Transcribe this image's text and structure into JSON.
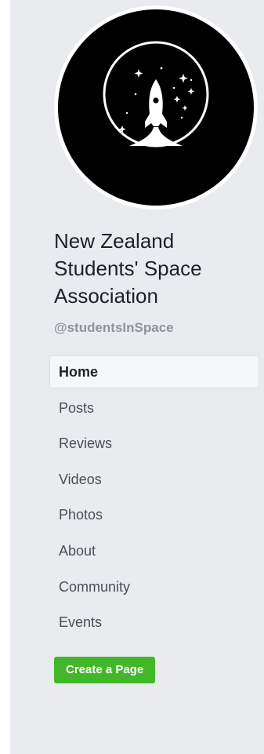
{
  "page": {
    "name": "New Zealand Students' Space Association",
    "handle": "@studentsInSpace",
    "avatar_icon": "rocket-logo-icon"
  },
  "nav": {
    "items": [
      {
        "label": "Home",
        "active": true
      },
      {
        "label": "Posts"
      },
      {
        "label": "Reviews"
      },
      {
        "label": "Videos"
      },
      {
        "label": "Photos"
      },
      {
        "label": "About"
      },
      {
        "label": "Community"
      },
      {
        "label": "Events"
      }
    ]
  },
  "actions": {
    "create_page_label": "Create a Page"
  },
  "colors": {
    "panel_bg": "#e9ebee",
    "create_button": "#42b72a",
    "handle_text": "#90949c"
  }
}
